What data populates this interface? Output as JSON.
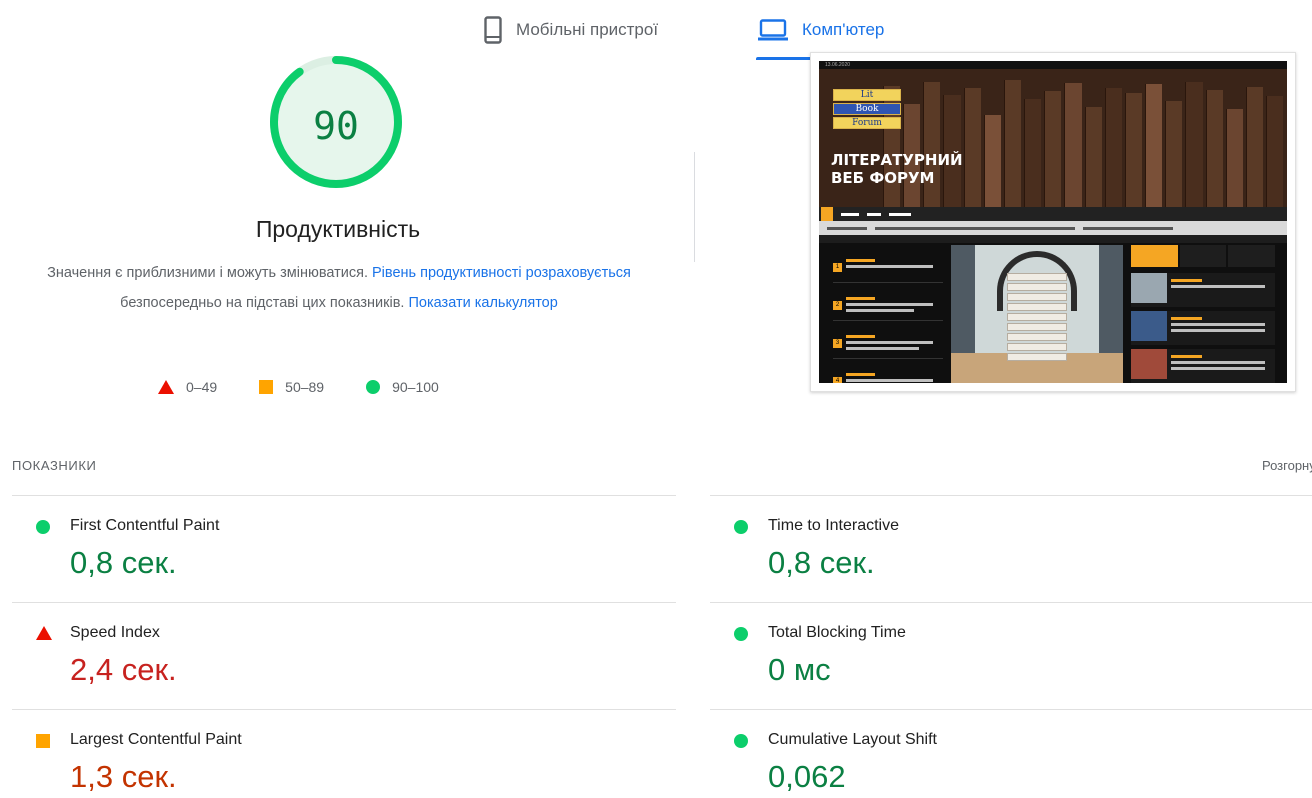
{
  "tabs": {
    "mobile_label": "Мобільні пристрої",
    "desktop_label": "Комп'ютер",
    "active": "desktop"
  },
  "performance": {
    "score": "90",
    "score_fraction": 0.9,
    "title": "Продуктивність",
    "desc_part1": "Значення є приблизними і можуть змінюватися. ",
    "desc_link1": "Рівень продуктивності розраховується",
    "desc_part2": " безпосередньо на підставі цих показників. ",
    "desc_link2": "Показати калькулятор"
  },
  "legend": {
    "fail": "0–49",
    "average": "50–89",
    "pass": "90–100"
  },
  "colors": {
    "pass": "#0cce6b",
    "pass_text": "#0b8043",
    "average": "#ffa400",
    "average_text": "#c33300",
    "fail": "#eb0f00",
    "fail_text": "#c7221f",
    "accent": "#1a73e8"
  },
  "screenshot": {
    "date": "13.06.2020",
    "site_title_line1": "ЛІТЕРАТУРНИЙ",
    "site_title_line2": "ВЕБ ФОРУМ",
    "logo_words": [
      "Lit",
      "Book",
      "Forum"
    ]
  },
  "metrics": {
    "section_label": "ПОКАЗНИКИ",
    "expand_label": "Розгорнути",
    "items": [
      {
        "name": "First Contentful Paint",
        "value": "0,8 сек.",
        "status": "pass"
      },
      {
        "name": "Time to Interactive",
        "value": "0,8 сек.",
        "status": "pass"
      },
      {
        "name": "Speed Index",
        "value": "2,4 сек.",
        "status": "fail"
      },
      {
        "name": "Total Blocking Time",
        "value": "0 мс",
        "status": "pass"
      },
      {
        "name": "Largest Contentful Paint",
        "value": "1,3 сек.",
        "status": "average"
      },
      {
        "name": "Cumulative Layout Shift",
        "value": "0,062",
        "status": "pass"
      }
    ]
  }
}
